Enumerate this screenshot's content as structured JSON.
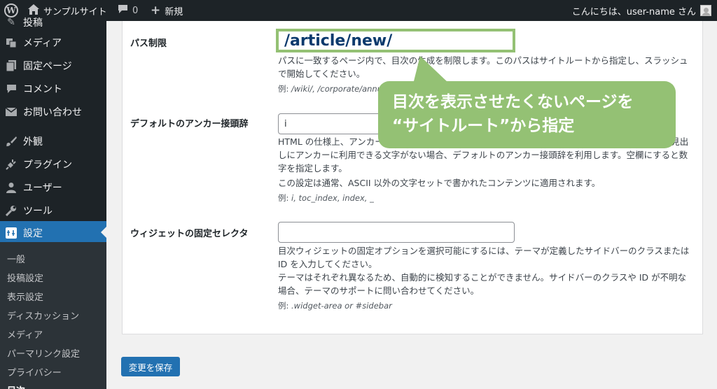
{
  "adminbar": {
    "site_name": "サンプルサイト",
    "comment_count": "0",
    "new_label": "新規",
    "greeting": "こんにちは、user-name さん"
  },
  "sidebar": {
    "items": [
      {
        "label": "投稿",
        "icon": "pin-icon"
      },
      {
        "label": "メディア",
        "icon": "media-icon"
      },
      {
        "label": "固定ページ",
        "icon": "page-icon"
      },
      {
        "label": "コメント",
        "icon": "comment-icon"
      },
      {
        "label": "お問い合わせ",
        "icon": "mail-icon"
      },
      {
        "label": "外観",
        "icon": "brush-icon"
      },
      {
        "label": "プラグイン",
        "icon": "plugin-icon"
      },
      {
        "label": "ユーザー",
        "icon": "user-icon"
      },
      {
        "label": "ツール",
        "icon": "wrench-icon"
      },
      {
        "label": "設定",
        "icon": "settings-icon"
      }
    ],
    "submenu": [
      "一般",
      "投稿設定",
      "表示設定",
      "ディスカッション",
      "メディア",
      "パーマリンク設定",
      "プライバシー",
      "目次"
    ]
  },
  "fields": {
    "path_restriction": {
      "label": "パス制限",
      "value": "/article/new/",
      "desc": "パスに一致するページ内で、目次の生成を制限します。このパスはサイトルートから指定し、スラッシュで開始してください。",
      "example_prefix": "例: ",
      "example": "/wiki/, /corporate/annual-reports/"
    },
    "default_anchor": {
      "label": "デフォルトのアンカー接頭辞",
      "value": "i",
      "desc1": "HTML の仕様上、アンカーに利用できる文字に制限があります。アンカー接頭辞を指定しない場合、見出しにアンカーに利用できる文字がない場合、デフォルトのアンカー接頭辞を利用します。空欄にすると数字を指定します。",
      "desc2": "この設定は通常、ASCII 以外の文字セットで書かれたコンテンツに適用されます。",
      "example_prefix": "例: ",
      "example": "i, toc_index, index, _"
    },
    "widget_selector": {
      "label": "ウィジェットの固定セレクタ",
      "value": "",
      "desc1": "目次ウィジェットの固定オプションを選択可能にするには、テーマが定義したサイドバーのクラスまたは ID を入力してください。",
      "desc2": "テーマはそれぞれ異なるため、自動的に検知することができません。サイドバーのクラスや ID が不明な場合、テーマのサポートに問い合わせてください。",
      "example_prefix": "例: ",
      "example": ".widget-area or #sidebar"
    }
  },
  "save_label": "変更を保存",
  "callout": {
    "line1": "目次を表示させたくないページを",
    "line2": "“サイトルート”から指定"
  },
  "colors": {
    "adminbar": "#1d2327",
    "accent": "#2271b1",
    "callout": "#94c174"
  }
}
